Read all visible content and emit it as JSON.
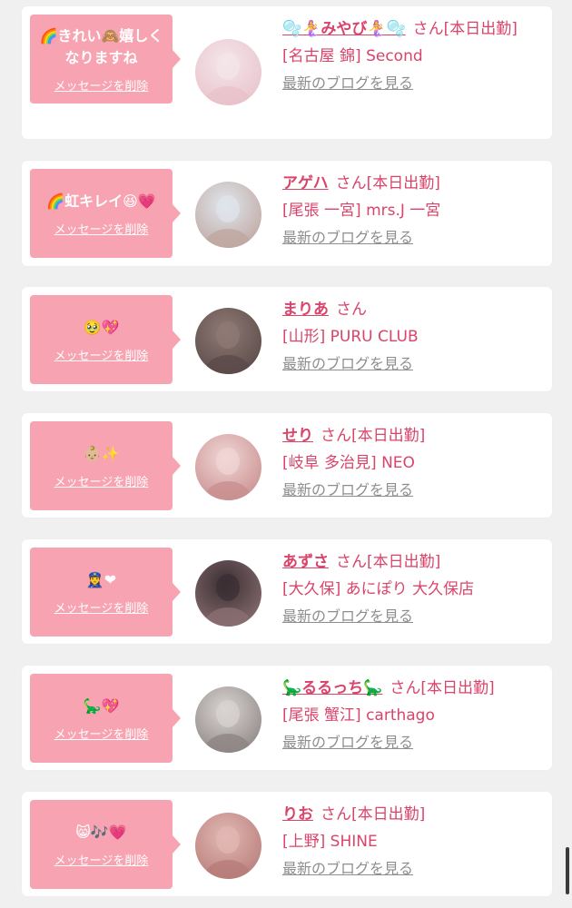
{
  "delete_label": "メッセージを削除",
  "blog_label": "最新のブログを見る",
  "honorific": "さん",
  "colors": {
    "bubble": "#f8a3b1",
    "name": "#d9446a",
    "link_gray": "#8e8e8e",
    "card_bg": "#ffffff",
    "page_bg": "#f0f0f0"
  },
  "items": [
    {
      "message": "🌈きれい🙈嬉しくなりますね",
      "name": "🫧🧜‍♀️みやび🧜‍♀️🫧",
      "status": "[本日出勤]",
      "shop": "[名古屋 錦] Second",
      "avatar_colors": [
        "#f4e6ea",
        "#e8c2cb"
      ]
    },
    {
      "message": "🌈虹キレイ😆💗",
      "name": "アゲハ",
      "status": "[本日出勤]",
      "shop": "[尾張 一宮] mrs.J 一宮",
      "avatar_colors": [
        "#dfe6ec",
        "#bfa6a0"
      ]
    },
    {
      "message": "🥹💖",
      "name": "まりあ",
      "status": "",
      "shop": "[山形] PURU CLUB",
      "avatar_colors": [
        "#8f7a75",
        "#5a4a48"
      ]
    },
    {
      "message": "👶🏼✨",
      "name": "せり",
      "status": "[本日出勤]",
      "shop": "[岐阜 多治見] NEO",
      "avatar_colors": [
        "#f1d6d6",
        "#c98e8e"
      ]
    },
    {
      "message": "👮‍♀️❤",
      "name": "あずさ",
      "status": "[本日出勤]",
      "shop": "[大久保] あにぽり 大久保店",
      "avatar_colors": [
        "#3a2e33",
        "#8b6f72"
      ]
    },
    {
      "message": "🦕💖",
      "name": "🦕るるっち🦕",
      "status": "[本日出勤]",
      "shop": "[尾張 蟹江] carthago",
      "avatar_colors": [
        "#d9d4d2",
        "#8d8583"
      ]
    },
    {
      "message": "😸🎶💗",
      "name": "りお",
      "status": "[本日出勤]",
      "shop": "[上野] SHINE",
      "avatar_colors": [
        "#e2b8b4",
        "#b77c78"
      ]
    }
  ]
}
